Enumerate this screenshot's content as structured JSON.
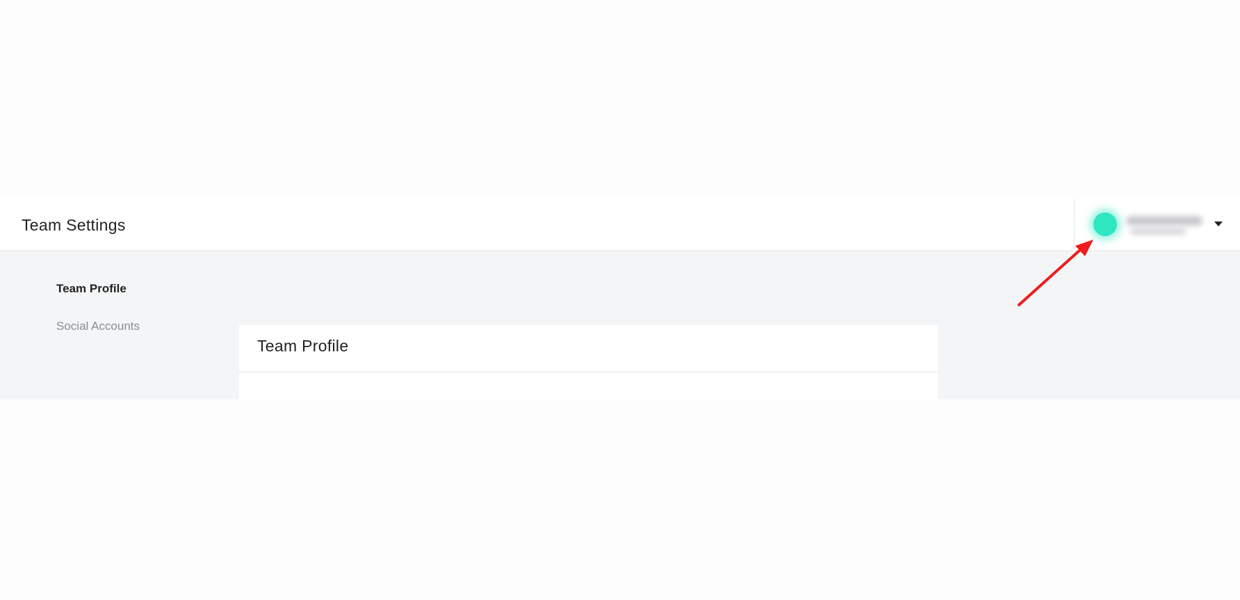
{
  "header": {
    "title": "Team Settings"
  },
  "user_menu": {
    "avatar_color": "#2ee6c0",
    "caret_icon": "chevron-down-icon"
  },
  "sidenav": {
    "items": [
      {
        "label": "Team Profile",
        "active": true
      },
      {
        "label": "Social Accounts",
        "active": false
      }
    ]
  },
  "panel": {
    "title": "Team Profile"
  },
  "annotation": {
    "arrow_color": "#ee1c1c"
  }
}
